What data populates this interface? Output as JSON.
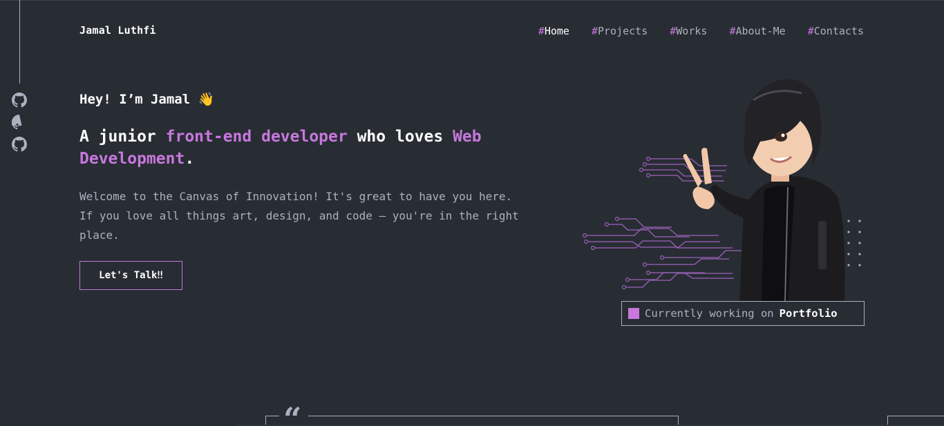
{
  "header": {
    "logo": "Jamal Luthfi",
    "nav": [
      {
        "hash": "#",
        "label": "Home",
        "active": true
      },
      {
        "hash": "#",
        "label": "Projects",
        "active": false
      },
      {
        "hash": "#",
        "label": "Works",
        "active": false
      },
      {
        "hash": "#",
        "label": "About-Me",
        "active": false
      },
      {
        "hash": "#",
        "label": "Contacts",
        "active": false
      }
    ]
  },
  "social": {
    "icons": [
      "github-icon",
      "github-icon",
      "github-icon"
    ]
  },
  "hero": {
    "greeting": "Hey! I’m Jamal 👋",
    "headline": {
      "part1": "A junior ",
      "accent1": "front-end developer",
      "part2": " who loves ",
      "accent2": "Web Development",
      "part3": "."
    },
    "intro": "Welcome to the Canvas of Innovation! It's great to have you here. If you love all things art, design, and code — you're in the right place.",
    "cta_label": "Let's Talk‼"
  },
  "status": {
    "prefix": "Currently working on",
    "project": "Portfolio"
  },
  "quote": {
    "mark": "“"
  },
  "colors": {
    "background": "#282c33",
    "accent": "#c778dd",
    "muted": "#abb2bf",
    "text": "#ffffff"
  }
}
